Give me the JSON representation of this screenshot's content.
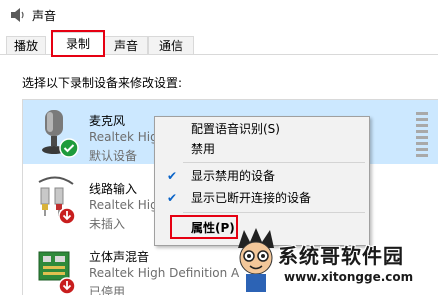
{
  "window": {
    "title": "声音"
  },
  "tabs": [
    {
      "label": "播放"
    },
    {
      "label": "录制"
    },
    {
      "label": "声音"
    },
    {
      "label": "通信"
    }
  ],
  "instruction": "选择以下录制设备来修改设置:",
  "devices": [
    {
      "name": "麦克风",
      "driver": "Realtek High",
      "status": "默认设备",
      "icon": "microphone-icon",
      "badge": "check"
    },
    {
      "name": "线路输入",
      "driver": "Realtek High",
      "status": "未插入",
      "icon": "line-in-icon",
      "badge": "down-arrow"
    },
    {
      "name": "立体声混音",
      "driver": "Realtek High Definition A",
      "status": "已停用",
      "icon": "stereo-mix-icon",
      "badge": "down-arrow"
    }
  ],
  "context_menu": {
    "items": [
      {
        "label": "配置语音识别(S)",
        "checked": false
      },
      {
        "label": "禁用",
        "checked": false
      },
      {
        "label": "显示禁用的设备",
        "checked": true
      },
      {
        "label": "显示已断开连接的设备",
        "checked": true
      },
      {
        "label": "属性(P)",
        "checked": false
      }
    ]
  },
  "watermark": {
    "brand": "系统哥软件园",
    "url": "www.xitongge.com"
  },
  "colors": {
    "highlight_red": "#e60012",
    "selection_blue": "#cce8ff",
    "check_blue": "#0a64c8",
    "default_green": "#1e9b3c"
  }
}
